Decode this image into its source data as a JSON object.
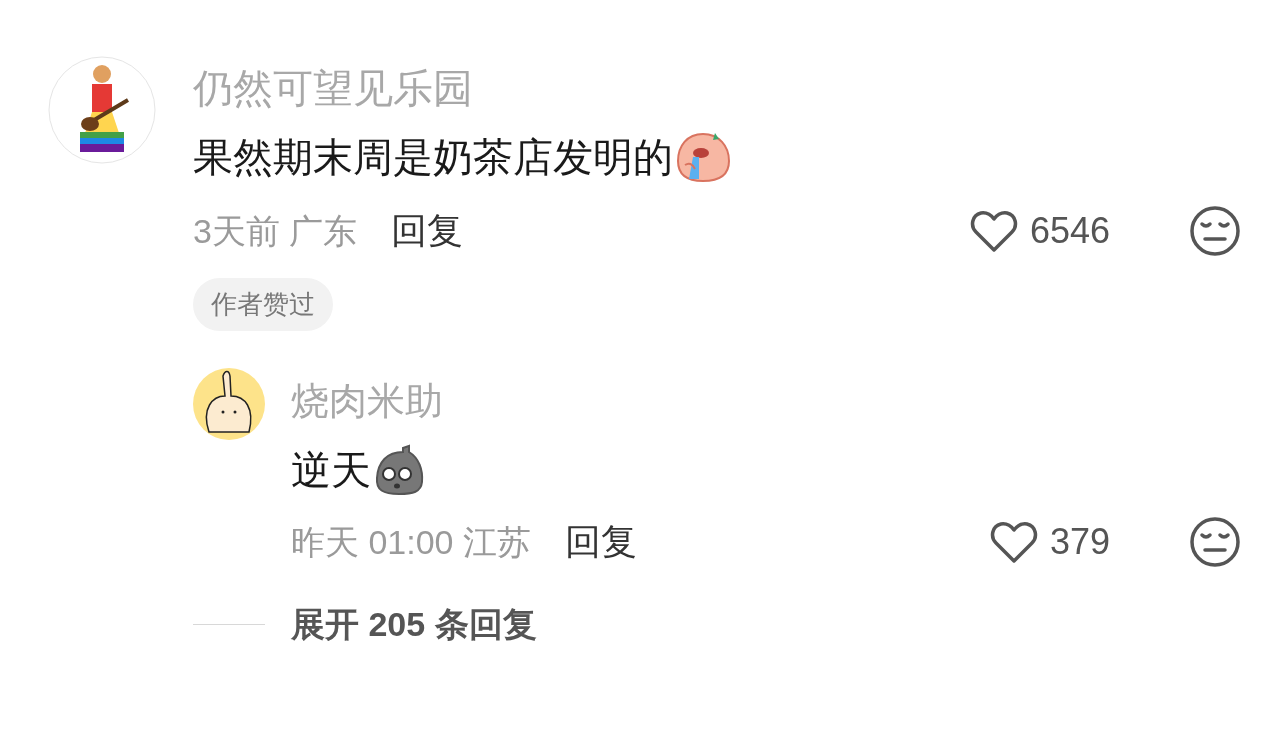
{
  "comments": [
    {
      "username": "仍然可望见乐园",
      "text": "果然期末周是奶茶店发明的",
      "kind": "crying",
      "time": "3天前",
      "location": "广东",
      "reply_label": "回复",
      "likes": "6546",
      "liked": false,
      "badge": "作者赞过",
      "replies": [
        {
          "username": "烧肉米助",
          "text": "逆天",
          "kind": "stone",
          "time": "昨天 01:00",
          "location": "江苏",
          "reply_label": "回复",
          "likes": "379",
          "liked": false
        }
      ],
      "expand_label": "展开 205 条回复"
    }
  ]
}
